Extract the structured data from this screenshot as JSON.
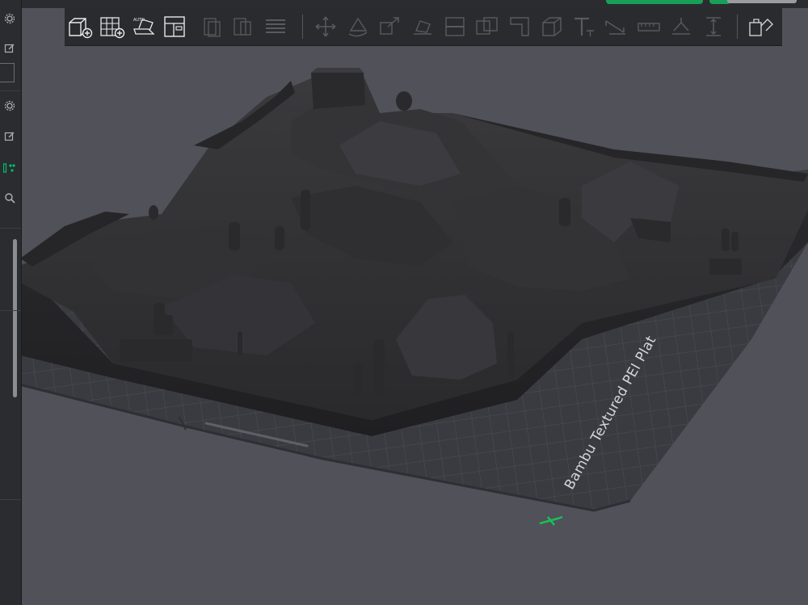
{
  "toolbar": {
    "groups": [
      [
        "add-object",
        "add-plate",
        "auto-orient",
        "arrange"
      ],
      [
        "split-objects",
        "split-parts",
        "layers"
      ],
      [
        "move",
        "rotate",
        "scale",
        "lay-on-face",
        "cut",
        "boolean",
        "support-painting",
        "seam-painting",
        "measure",
        "text",
        "variable-layer",
        "assembly",
        "mesh-tools",
        "fit"
      ],
      [
        "assembly-view"
      ]
    ]
  },
  "left_rail": {
    "icons": [
      "gear-icon",
      "edit-icon",
      "gear-icon",
      "edit-icon",
      "group-icon",
      "search-icon"
    ],
    "active": "group-icon"
  },
  "build_plate": {
    "name": "Bambu Textured PEI Plat"
  },
  "colors": {
    "background": "#505159",
    "plate": "#3a3b40",
    "model": "#2d2d30",
    "accent": "#19a058"
  }
}
